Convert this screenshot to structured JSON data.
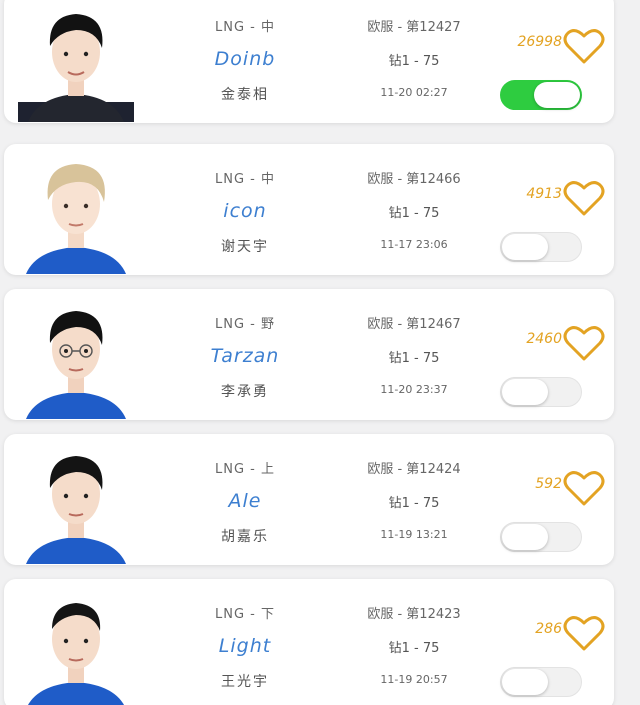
{
  "colors": {
    "accent_name": "#3d7fd0",
    "likes": "#e3a323",
    "toggle_on": "#2ecc40"
  },
  "players": [
    {
      "team_role": "LNG - 中",
      "ign": "Doinb",
      "real_name": "金泰相",
      "server_rank": "欧服 - 第12427",
      "tier": "钻1 - 75",
      "time": "11-20 02:27",
      "likes": "26998",
      "toggle_on": true
    },
    {
      "team_role": "LNG - 中",
      "ign": "icon",
      "real_name": "谢天宇",
      "server_rank": "欧服 - 第12466",
      "tier": "钻1 - 75",
      "time": "11-17 23:06",
      "likes": "4913",
      "toggle_on": false
    },
    {
      "team_role": "LNG - 野",
      "ign": "Tarzan",
      "real_name": "李承勇",
      "server_rank": "欧服 - 第12467",
      "tier": "钻1 - 75",
      "time": "11-20 23:37",
      "likes": "2460",
      "toggle_on": false
    },
    {
      "team_role": "LNG - 上",
      "ign": "Ale",
      "real_name": "胡嘉乐",
      "server_rank": "欧服 - 第12424",
      "tier": "钻1 - 75",
      "time": "11-19 13:21",
      "likes": "592",
      "toggle_on": false
    },
    {
      "team_role": "LNG - 下",
      "ign": "Light",
      "real_name": "王光宇",
      "server_rank": "欧服 - 第12423",
      "tier": "钻1 - 75",
      "time": "11-19 20:57",
      "likes": "286",
      "toggle_on": false
    }
  ]
}
